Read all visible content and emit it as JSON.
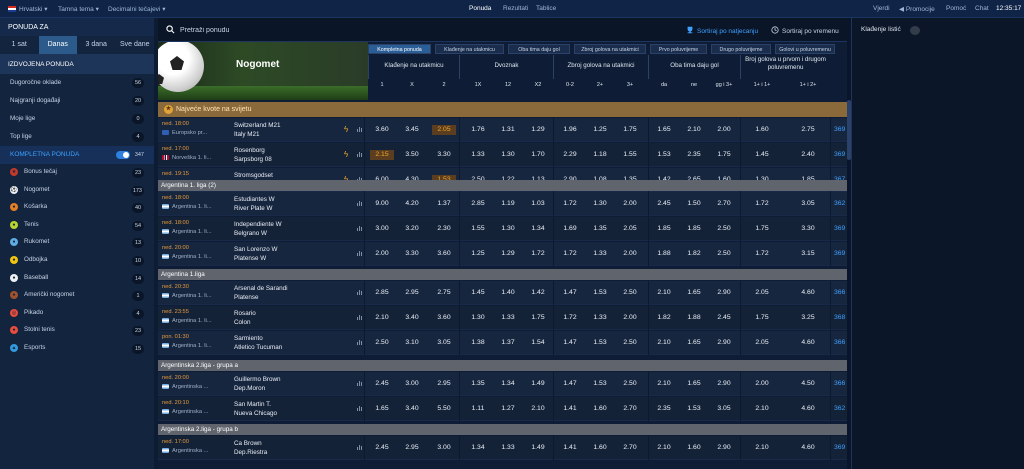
{
  "topbar": {
    "language": "Hrvatski",
    "theme": "Tamna tema",
    "odds_format": "Decimalni tečajevi",
    "nav": [
      "Ponuda",
      "Rezultati",
      "Tablice"
    ],
    "right": {
      "login": "Vjerdi",
      "promo": "Promocije",
      "help": "Pomoć",
      "chat": "Chat",
      "clock": "12:35:17"
    }
  },
  "sidebar": {
    "ponuda_za": "PONUDA ZA",
    "time_tabs": [
      "1 sat",
      "Danas",
      "3 dana",
      "Sve dane"
    ],
    "izdvojena": "IZDVOJENA PONUDA",
    "featured": [
      {
        "label": "Dugoročne oklade",
        "count": "56"
      },
      {
        "label": "Najgranji događaji",
        "count": "20"
      },
      {
        "label": "Moje lige",
        "count": "0"
      },
      {
        "label": "Top lige",
        "count": "4"
      }
    ],
    "kompletna": {
      "label": "KOMPLETNA PONUDA",
      "count": "347"
    },
    "sports": [
      {
        "label": "Bonus tečaj",
        "count": "23",
        "icon": "bonus-icon",
        "color": "#c0392b",
        "glyph": "★"
      },
      {
        "label": "Nogomet",
        "count": "173",
        "icon": "football-icon",
        "color": "#e9eef6",
        "glyph": "⚽"
      },
      {
        "label": "Košarka",
        "count": "40",
        "icon": "basketball-icon",
        "color": "#e67e22",
        "glyph": "●"
      },
      {
        "label": "Tenis",
        "count": "54",
        "icon": "tennis-icon",
        "color": "#b8d32f",
        "glyph": "●"
      },
      {
        "label": "Rukomet",
        "count": "13",
        "icon": "handball-icon",
        "color": "#5dade2",
        "glyph": "●"
      },
      {
        "label": "Odbojka",
        "count": "10",
        "icon": "volleyball-icon",
        "color": "#f1c40f",
        "glyph": "●"
      },
      {
        "label": "Baseball",
        "count": "14",
        "icon": "baseball-icon",
        "color": "#ecf0f1",
        "glyph": "●"
      },
      {
        "label": "Američki nogomet",
        "count": "1",
        "icon": "american-football-icon",
        "color": "#a0522d",
        "glyph": "●"
      },
      {
        "label": "Pikado",
        "count": "4",
        "icon": "darts-icon",
        "color": "#e74c3c",
        "glyph": "◎"
      },
      {
        "label": "Stolni tenis",
        "count": "23",
        "icon": "table-tennis-icon",
        "color": "#e74c3c",
        "glyph": "●"
      },
      {
        "label": "Esports",
        "count": "15",
        "icon": "esports-icon",
        "color": "#3498db",
        "glyph": "▲"
      }
    ]
  },
  "search": {
    "placeholder": "Pretraži ponudu"
  },
  "sort": {
    "by_competition": "Sortiraj po natjecanju",
    "by_time": "Sortiraj po vremenu"
  },
  "banner": {
    "title": "Nogomet"
  },
  "market_tabs": [
    "Kompletna ponuda",
    "Klađenje na utakmicu",
    "Oba tima daju gol",
    "Zbroj golova na utakmici",
    "Prvo poluvrijeme",
    "Drugo poluvrijeme",
    "Golovi u poluvremenu"
  ],
  "headers": {
    "groups": [
      "Klađenje na utakmicu",
      "Dvoznak",
      "Zbroj golova na utakmici",
      "Oba tima daju gol",
      "Broj golova u prvom i drugom poluvremenu"
    ],
    "cols": [
      "1",
      "X",
      "2",
      "1X",
      "12",
      "X2",
      "0-2",
      "2+",
      "3+",
      "da",
      "ne",
      "gg i 3+",
      "1+ i 1+",
      "1+ i 2+"
    ]
  },
  "promo": {
    "label": "Najveće kvote na svijetu"
  },
  "colors": {
    "accent": "#3ea0ff",
    "highlight": "#f0a52c",
    "league_bar": "#5f646d"
  },
  "leagues": [
    "Argentina 1. liga (2)",
    "Argentina 1.liga",
    "Argentinska 2.liga - grupa a",
    "Argentinska 2.liga - grupa b"
  ],
  "matches": [
    {
      "date": "ned. 18:00",
      "comp": "Europsko pr...",
      "flag": "fl-eu",
      "home": "Switzerland M21",
      "away": "Italy M21",
      "bolt": true,
      "odds": [
        "3.60",
        "3.45",
        "2.05",
        "1.76",
        "1.31",
        "1.29",
        "1.96",
        "1.25",
        "1.75",
        "1.65",
        "2.10",
        "2.00",
        "1.60",
        "2.75"
      ],
      "hi": [
        2
      ],
      "more": "369"
    },
    {
      "date": "ned. 17:00",
      "comp": "Norveška 1. li...",
      "flag": "fl-no",
      "home": "Rosenborg",
      "away": "Sarpsborg 08",
      "bolt": true,
      "odds": [
        "2.15",
        "3.50",
        "3.30",
        "1.33",
        "1.30",
        "1.70",
        "2.29",
        "1.18",
        "1.55",
        "1.53",
        "2.35",
        "1.75",
        "1.45",
        "2.40"
      ],
      "hi": [
        0
      ],
      "more": "369"
    },
    {
      "date": "ned. 19:15",
      "comp": "Norveška 1. li...",
      "flag": "fl-no",
      "home": "Stromsgodset",
      "away": "Bodo",
      "bolt": true,
      "odds": [
        "6.00",
        "4.30",
        "1.53",
        "2.50",
        "1.22",
        "1.13",
        "2.90",
        "1.08",
        "1.35",
        "1.42",
        "2.65",
        "1.60",
        "1.30",
        "1.85"
      ],
      "hi": [
        2
      ],
      "more": "367"
    },
    {
      "date": "ned. 18:00",
      "comp": "Argentina 1. li...",
      "flag": "fl-ar",
      "home": "Estudiantes W",
      "away": "River Plate W",
      "bolt": false,
      "odds": [
        "9.00",
        "4.20",
        "1.37",
        "2.85",
        "1.19",
        "1.03",
        "1.72",
        "1.30",
        "2.00",
        "2.45",
        "1.50",
        "2.70",
        "1.72",
        "3.05"
      ],
      "hi": [],
      "more": "362"
    },
    {
      "date": "ned. 18:00",
      "comp": "Argentina 1. li...",
      "flag": "fl-ar",
      "home": "Independiente W",
      "away": "Belgrano W",
      "bolt": false,
      "odds": [
        "3.00",
        "3.20",
        "2.30",
        "1.55",
        "1.30",
        "1.34",
        "1.69",
        "1.35",
        "2.05",
        "1.85",
        "1.85",
        "2.50",
        "1.75",
        "3.30"
      ],
      "hi": [],
      "more": "369"
    },
    {
      "date": "ned. 20:00",
      "comp": "Argentina 1. li...",
      "flag": "fl-ar",
      "home": "San Lorenzo W",
      "away": "Platense W",
      "bolt": false,
      "odds": [
        "2.00",
        "3.30",
        "3.60",
        "1.25",
        "1.29",
        "1.72",
        "1.72",
        "1.33",
        "2.00",
        "1.88",
        "1.82",
        "2.50",
        "1.72",
        "3.15"
      ],
      "hi": [],
      "more": "369"
    },
    {
      "date": "ned. 20:30",
      "comp": "Argentina 1. li...",
      "flag": "fl-ar",
      "home": "Arsenal de Sarandi",
      "away": "Platense",
      "bolt": false,
      "odds": [
        "2.85",
        "2.95",
        "2.75",
        "1.45",
        "1.40",
        "1.42",
        "1.47",
        "1.53",
        "2.50",
        "2.10",
        "1.65",
        "2.90",
        "2.05",
        "4.60"
      ],
      "hi": [],
      "more": "366"
    },
    {
      "date": "ned. 23:55",
      "comp": "Argentina 1. li...",
      "flag": "fl-ar",
      "home": "Rosario",
      "away": "Colon",
      "bolt": false,
      "odds": [
        "2.10",
        "3.40",
        "3.60",
        "1.30",
        "1.33",
        "1.75",
        "1.72",
        "1.33",
        "2.00",
        "1.82",
        "1.88",
        "2.45",
        "1.75",
        "3.25"
      ],
      "hi": [],
      "more": "368"
    },
    {
      "date": "pon. 01:30",
      "comp": "Argentina 1. li...",
      "flag": "fl-ar",
      "home": "Sarmiento",
      "away": "Atletico Tucuman",
      "bolt": false,
      "odds": [
        "2.50",
        "3.10",
        "3.05",
        "1.38",
        "1.37",
        "1.54",
        "1.47",
        "1.53",
        "2.50",
        "2.10",
        "1.65",
        "2.90",
        "2.05",
        "4.60"
      ],
      "hi": [],
      "more": "366"
    },
    {
      "date": "ned. 20:00",
      "comp": "Argentinska ...",
      "flag": "fl-ar",
      "home": "Guillermo Brown",
      "away": "Dep.Moron",
      "bolt": false,
      "odds": [
        "2.45",
        "3.00",
        "2.95",
        "1.35",
        "1.34",
        "1.49",
        "1.47",
        "1.53",
        "2.50",
        "2.10",
        "1.65",
        "2.90",
        "2.00",
        "4.50"
      ],
      "hi": [],
      "more": "366"
    },
    {
      "date": "ned. 20:10",
      "comp": "Argentinska ...",
      "flag": "fl-ar",
      "home": "San Martin T.",
      "away": "Nueva Chicago",
      "bolt": false,
      "odds": [
        "1.65",
        "3.40",
        "5.50",
        "1.11",
        "1.27",
        "2.10",
        "1.41",
        "1.60",
        "2.70",
        "2.35",
        "1.53",
        "3.05",
        "2.10",
        "4.60"
      ],
      "hi": [],
      "more": "362"
    },
    {
      "date": "ned. 17:00",
      "comp": "Argentinska ...",
      "flag": "fl-ar",
      "home": "Ca Brown",
      "away": "Dep.Riestra",
      "bolt": false,
      "odds": [
        "2.45",
        "2.95",
        "3.00",
        "1.34",
        "1.33",
        "1.49",
        "1.41",
        "1.60",
        "2.70",
        "2.10",
        "1.60",
        "2.90",
        "2.10",
        "4.60"
      ],
      "hi": [],
      "more": "369"
    }
  ],
  "betslip": {
    "title": "Klađenje listić"
  }
}
